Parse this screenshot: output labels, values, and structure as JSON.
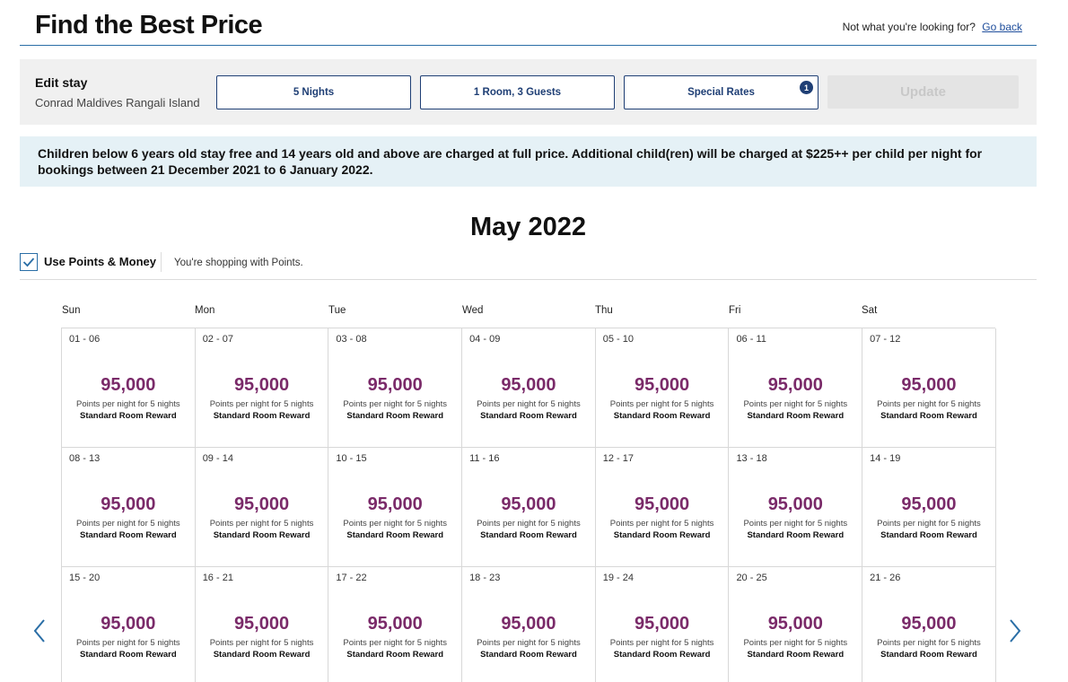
{
  "header": {
    "title": "Find the Best Price",
    "not_looking": "Not what you're looking for?",
    "go_back": "Go back"
  },
  "edit_stay": {
    "title": "Edit stay",
    "hotel": "Conrad Maldives Rangali Island",
    "nights": "5 Nights",
    "rooms_guests": "1 Room, 3 Guests",
    "special_rates": "Special Rates",
    "special_rates_badge": "1",
    "update": "Update"
  },
  "notice": "Children below 6 years old stay free and 14 years old and above are charged at full price. Additional child(ren) will be charged at $225++ per child per night for bookings between 21 December 2021 to 6 January 2022.",
  "calendar": {
    "month": "May 2022",
    "use_points_label": "Use Points & Money",
    "use_points_checked": true,
    "shopping_note": "You're shopping with Points.",
    "weekdays": [
      "Sun",
      "Mon",
      "Tue",
      "Wed",
      "Thu",
      "Fri",
      "Sat"
    ],
    "cells": [
      {
        "dates": "01 - 06",
        "price": "95,000",
        "sub": "Points per night for 5 nights",
        "room": "Standard Room Reward"
      },
      {
        "dates": "02 - 07",
        "price": "95,000",
        "sub": "Points per night for 5 nights",
        "room": "Standard Room Reward"
      },
      {
        "dates": "03 - 08",
        "price": "95,000",
        "sub": "Points per night for 5 nights",
        "room": "Standard Room Reward"
      },
      {
        "dates": "04 - 09",
        "price": "95,000",
        "sub": "Points per night for 5 nights",
        "room": "Standard Room Reward"
      },
      {
        "dates": "05 - 10",
        "price": "95,000",
        "sub": "Points per night for 5 nights",
        "room": "Standard Room Reward"
      },
      {
        "dates": "06 - 11",
        "price": "95,000",
        "sub": "Points per night for 5 nights",
        "room": "Standard Room Reward"
      },
      {
        "dates": "07 - 12",
        "price": "95,000",
        "sub": "Points per night for 5 nights",
        "room": "Standard Room Reward"
      },
      {
        "dates": "08 - 13",
        "price": "95,000",
        "sub": "Points per night for 5 nights",
        "room": "Standard Room Reward"
      },
      {
        "dates": "09 - 14",
        "price": "95,000",
        "sub": "Points per night for 5 nights",
        "room": "Standard Room Reward"
      },
      {
        "dates": "10 - 15",
        "price": "95,000",
        "sub": "Points per night for 5 nights",
        "room": "Standard Room Reward"
      },
      {
        "dates": "11 - 16",
        "price": "95,000",
        "sub": "Points per night for 5 nights",
        "room": "Standard Room Reward"
      },
      {
        "dates": "12 - 17",
        "price": "95,000",
        "sub": "Points per night for 5 nights",
        "room": "Standard Room Reward"
      },
      {
        "dates": "13 - 18",
        "price": "95,000",
        "sub": "Points per night for 5 nights",
        "room": "Standard Room Reward"
      },
      {
        "dates": "14 - 19",
        "price": "95,000",
        "sub": "Points per night for 5 nights",
        "room": "Standard Room Reward"
      },
      {
        "dates": "15 - 20",
        "price": "95,000",
        "sub": "Points per night for 5 nights",
        "room": "Standard Room Reward"
      },
      {
        "dates": "16 - 21",
        "price": "95,000",
        "sub": "Points per night for 5 nights",
        "room": "Standard Room Reward"
      },
      {
        "dates": "17 - 22",
        "price": "95,000",
        "sub": "Points per night for 5 nights",
        "room": "Standard Room Reward"
      },
      {
        "dates": "18 - 23",
        "price": "95,000",
        "sub": "Points per night for 5 nights",
        "room": "Standard Room Reward"
      },
      {
        "dates": "19 - 24",
        "price": "95,000",
        "sub": "Points per night for 5 nights",
        "room": "Standard Room Reward"
      },
      {
        "dates": "20 - 25",
        "price": "95,000",
        "sub": "Points per night for 5 nights",
        "room": "Standard Room Reward"
      },
      {
        "dates": "21 - 26",
        "price": "95,000",
        "sub": "Points per night for 5 nights",
        "room": "Standard Room Reward"
      }
    ]
  },
  "icons": {
    "prev": "chevron-left-icon",
    "next": "chevron-right-icon",
    "check": "checkmark-icon"
  },
  "colors": {
    "accent": "#1f3f75",
    "price": "#7a2a69",
    "notice_bg": "#e5f1f6",
    "rule": "#2a6ea6"
  }
}
